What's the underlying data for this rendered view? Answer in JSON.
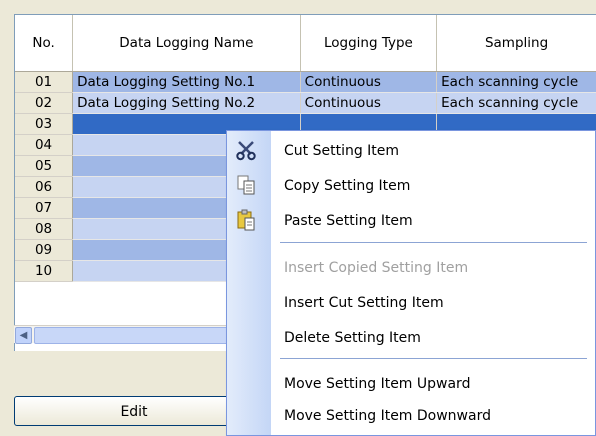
{
  "table": {
    "headers": [
      "No.",
      "Data Logging Name",
      "Logging Type",
      "Sampling"
    ],
    "rows": [
      {
        "no": "01",
        "name": "Data Logging Setting No.1",
        "type": "Continuous",
        "sampling": "Each scanning cycle"
      },
      {
        "no": "02",
        "name": "Data Logging Setting No.2",
        "type": "Continuous",
        "sampling": "Each scanning cycle"
      },
      {
        "no": "03",
        "name": "",
        "type": "",
        "sampling": ""
      },
      {
        "no": "04",
        "name": "",
        "type": "",
        "sampling": ""
      },
      {
        "no": "05",
        "name": "",
        "type": "",
        "sampling": ""
      },
      {
        "no": "06",
        "name": "",
        "type": "",
        "sampling": ""
      },
      {
        "no": "07",
        "name": "",
        "type": "",
        "sampling": ""
      },
      {
        "no": "08",
        "name": "",
        "type": "",
        "sampling": ""
      },
      {
        "no": "09",
        "name": "",
        "type": "",
        "sampling": ""
      },
      {
        "no": "10",
        "name": "",
        "type": "",
        "sampling": ""
      }
    ]
  },
  "edit_button": "Edit",
  "menu": {
    "items": [
      {
        "label": "Cut Setting Item",
        "icon": "scissors-icon",
        "enabled": true
      },
      {
        "label": "Copy Setting Item",
        "icon": "copy-icon",
        "enabled": true
      },
      {
        "label": "Paste Setting Item",
        "icon": "paste-icon",
        "enabled": true
      },
      {
        "label": "Insert Copied Setting Item",
        "enabled": false
      },
      {
        "label": "Insert Cut Setting Item",
        "enabled": true
      },
      {
        "label": "Delete Setting Item",
        "enabled": true
      },
      {
        "label": "Move Setting Item Upward",
        "enabled": true
      },
      {
        "label": "Move Setting Item Downward",
        "enabled": true
      }
    ]
  },
  "colors": {
    "row_dark": "#9fb7e6",
    "row_light": "#c6d4f2",
    "row_selected": "#316ac5",
    "menu_separator": "#8ca4d4"
  }
}
